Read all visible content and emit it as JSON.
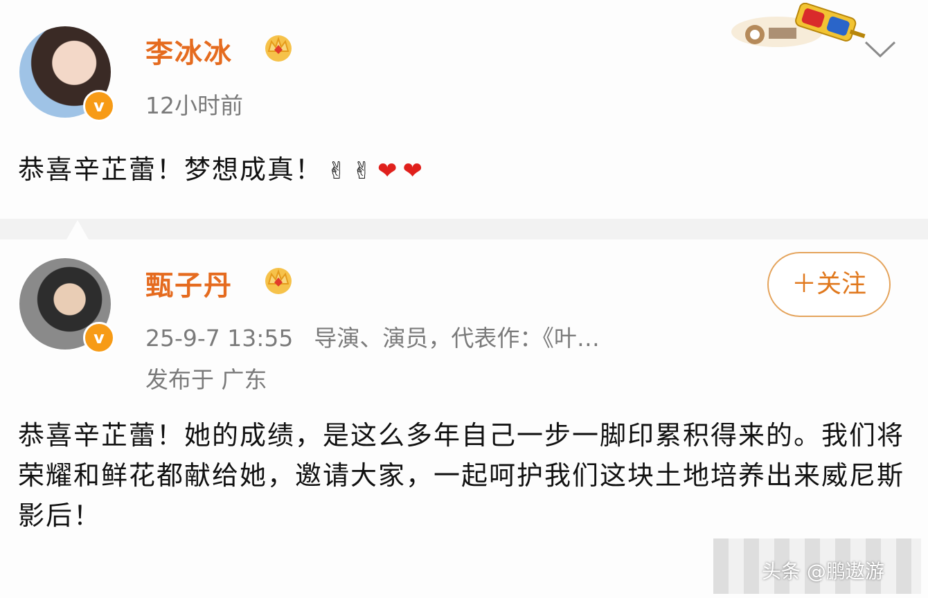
{
  "posts": [
    {
      "author": "李冰冰",
      "time": "12小时前",
      "content": "恭喜辛芷蕾！梦想成真！",
      "emojis": [
        "✌",
        "✌",
        "❤",
        "❤"
      ]
    },
    {
      "author": "甄子丹",
      "timestamp": "25-9-7 13:55",
      "bio": "导演、演员，代表作：《叶…",
      "location": "发布于 广东",
      "follow_label": "＋关注",
      "content": "恭喜辛芷蕾！她的成绩，是这么多年自己一步一脚印累积得来的。我们将荣耀和鲜花都献给她，邀请大家，一起呵护我们这块土地培养出来威尼斯影后！"
    }
  ],
  "verified_badge": "v",
  "watermark": "头条 @鹏遨游",
  "colors": {
    "name": "#e56b1f",
    "meta": "#7a7a7a",
    "verified": "#f79b16",
    "follow_border": "#e4a35b",
    "heart": "#e0201c"
  },
  "icons": [
    "crown-icon",
    "verified-icon",
    "chevron-down-icon",
    "3d-glasses-logo",
    "victory-hand-emoji",
    "heart-emoji"
  ]
}
